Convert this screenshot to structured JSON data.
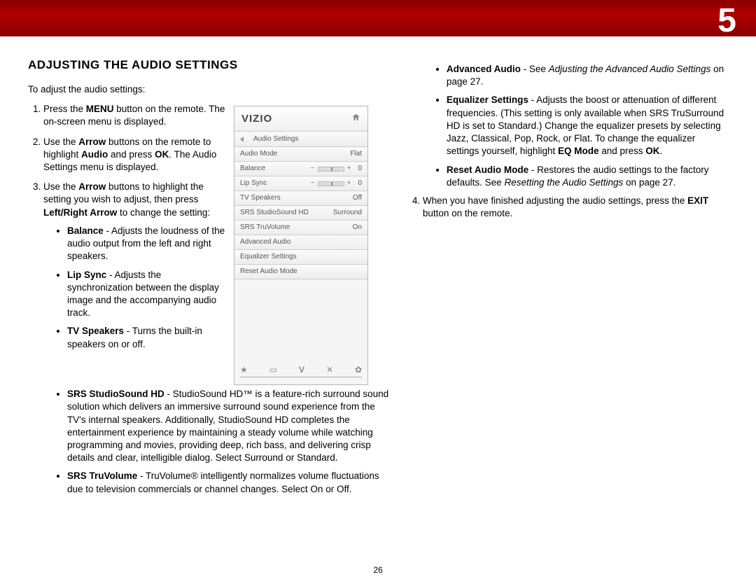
{
  "chapter": "5",
  "page_number": "26",
  "title": "ADJUSTING THE AUDIO SETTINGS",
  "intro": "To adjust the audio settings:",
  "steps": {
    "s1_a": "Press the ",
    "s1_b": "MENU",
    "s1_c": " button on the remote. The on-screen menu is displayed.",
    "s2_a": "Use the ",
    "s2_b": "Arrow",
    "s2_c": " buttons on the remote to highlight ",
    "s2_d": "Audio",
    "s2_e": " and press ",
    "s2_f": "OK",
    "s2_g": ". The Audio Settings menu is displayed.",
    "s3_a": "Use the ",
    "s3_b": "Arrow",
    "s3_c": " buttons to highlight the setting you wish to adjust, then press ",
    "s3_d": "Left/Right Arrow",
    "s3_e": " to change the setting:"
  },
  "bullets_left": {
    "balance_t": "Balance",
    "balance_d": " - Adjusts the loudness of the audio output from the left and right speakers.",
    "lipsync_t": "Lip Sync",
    "lipsync_d": " - Adjusts the synchronization between the display image and the accompanying audio track.",
    "tvsp_t": "TV Speakers",
    "tvsp_d": " - Turns the built-in speakers on or off.",
    "srs_t": "SRS StudioSound HD",
    "srs_d": " - StudioSound HD™ is a feature-rich surround sound solution which delivers an immersive surround sound experience from the TV's internal speakers. Additionally, StudioSound HD completes the entertainment experience by maintaining a steady volume while watching programming and movies, providing deep, rich bass, and delivering crisp details and clear, intelligible dialog. Select Surround or Standard.",
    "truv_t": "SRS TruVolume",
    "truv_d": " - TruVolume® intelligently normalizes volume fluctuations due to television commercials or channel changes. Select On or Off."
  },
  "bullets_right": {
    "adv_t": "Advanced Audio",
    "adv_a": " - See ",
    "adv_i": "Adjusting the Advanced Audio Settings",
    "adv_b": " on page 27.",
    "eq_t": "Equalizer Settings",
    "eq_a": " - Adjusts the boost or attenuation of different frequencies. (This setting is only available when SRS TruSurround HD is set to Standard.) Change the equalizer presets by selecting Jazz, Classical, Pop, Rock, or Flat. To change the equalizer settings yourself, highlight ",
    "eq_b": "EQ Mode",
    "eq_c": " and press ",
    "eq_d": "OK",
    "eq_e": ".",
    "reset_t": "Reset Audio Mode",
    "reset_a": " - Restores the audio settings to the factory defaults. See ",
    "reset_i": "Resetting the Audio Settings",
    "reset_b": " on page 27."
  },
  "step4_a": "When you have finished adjusting the audio settings, press the ",
  "step4_b": "EXIT",
  "step4_c": " button on the remote.",
  "panel": {
    "logo": "VIZIO",
    "sub": "Audio Settings",
    "rows": [
      {
        "l": "Audio Mode",
        "r": "Flat",
        "type": "text"
      },
      {
        "l": "Balance",
        "r": "0",
        "type": "slider"
      },
      {
        "l": "Lip Sync",
        "r": "0",
        "type": "slider"
      },
      {
        "l": "TV Speakers",
        "r": "Off",
        "type": "text"
      },
      {
        "l": "SRS StudioSound HD",
        "r": "Surround",
        "type": "text"
      },
      {
        "l": "SRS TruVolume",
        "r": "On",
        "type": "text"
      },
      {
        "l": "Advanced Audio",
        "r": "",
        "type": "text"
      },
      {
        "l": "Equalizer Settings",
        "r": "",
        "type": "text"
      },
      {
        "l": "Reset Audio Mode",
        "r": "",
        "type": "text"
      }
    ],
    "icons": [
      "★",
      "▭",
      "V",
      "✕",
      "✿"
    ]
  }
}
